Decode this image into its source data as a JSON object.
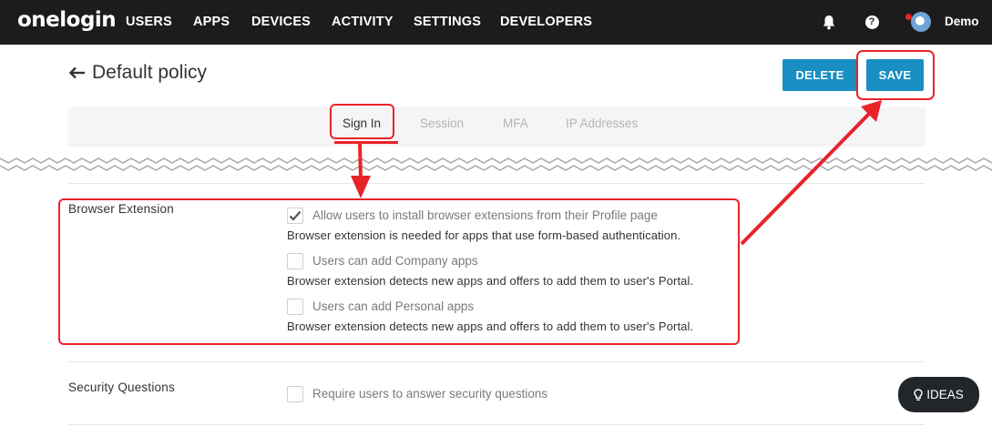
{
  "nav": {
    "logo": "onelogin",
    "links": [
      "USERS",
      "APPS",
      "DEVICES",
      "ACTIVITY",
      "SETTINGS",
      "DEVELOPERS"
    ],
    "help_glyph": "?",
    "user_name": "Demo",
    "icons": [
      "bell-icon",
      "help-icon",
      "avatar"
    ]
  },
  "header": {
    "title": "Default policy",
    "delete_label": "DELETE",
    "save_label": "SAVE"
  },
  "tabs": [
    "Sign In",
    "Session",
    "MFA",
    "IP Addresses"
  ],
  "active_tab": "Sign In",
  "sections": {
    "browser_extension": {
      "label": "Browser Extension",
      "options": [
        {
          "label": "Allow users to install browser extensions from their Profile page",
          "checked": true,
          "help": "Browser extension is needed for apps that use form-based authentication."
        },
        {
          "label": "Users can add Company apps",
          "checked": false,
          "help": "Browser extension detects new apps and offers to add them to user's Portal."
        },
        {
          "label": "Users can add Personal apps",
          "checked": false,
          "help": "Browser extension detects new apps and offers to add them to user's Portal."
        }
      ]
    },
    "security_questions": {
      "label": "Security Questions",
      "option": {
        "label": "Require users to answer security questions",
        "checked": false
      }
    }
  },
  "ideas_button": "IDEAS",
  "colors": {
    "nav_bg": "#1c1c1c",
    "accent": "#1a8fc4",
    "annotation": "#e8232a",
    "ideas_bg": "#22262b"
  }
}
